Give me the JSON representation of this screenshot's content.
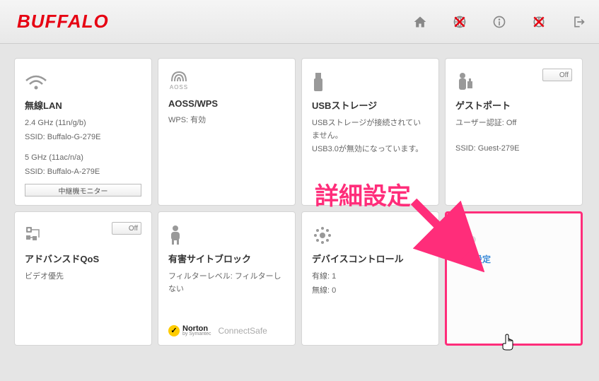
{
  "brand": "BUFFALO",
  "toggle_off": "Off",
  "cards": {
    "wlan": {
      "title": "無線LAN",
      "line1": "2.4 GHz (11n/g/b)",
      "line2": "SSID: Buffalo-G-279E",
      "line3": "5 GHz (11ac/n/a)",
      "line4": "SSID: Buffalo-A-279E",
      "repeater_btn": "中継機モニター"
    },
    "aoss": {
      "icon_label": "AOSS",
      "title": "AOSS/WPS",
      "line1": "WPS: 有効"
    },
    "usb": {
      "title": "USBストレージ",
      "line1": "USBストレージが接続されていません。",
      "line2": "USB3.0が無効になっています。"
    },
    "guest": {
      "title": "ゲストポート",
      "line1": "ユーザー認証: Off",
      "line2": "SSID: Guest-279E"
    },
    "qos": {
      "title": "アドバンスドQoS",
      "line1": "ビデオ優先"
    },
    "filter": {
      "title": "有害サイトブロック",
      "line1": "フィルターレベル: フィルターしない",
      "norton_brand": "Norton",
      "norton_sub": "by Symantec",
      "norton_cs": "ConnectSafe"
    },
    "device": {
      "title": "デバイスコントロール",
      "line1": "有線: 1",
      "line2": "無線: 0"
    },
    "advanced": {
      "title": "詳細設定"
    }
  },
  "annotation": "詳細設定"
}
